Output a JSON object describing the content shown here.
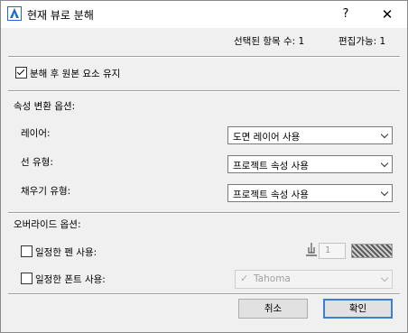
{
  "window": {
    "title": "현재 뷰로 분해",
    "help": "?",
    "close": "✕"
  },
  "info": {
    "selected": "선택된 항목 수: 1",
    "editable": "편집가능: 1"
  },
  "keep_original": {
    "label": "분해 후 원본 요소 유지",
    "checked": true
  },
  "attr_section": {
    "title": "속성 변환 옵션:",
    "layer": {
      "label": "레이어:",
      "value": "도면 레이어 사용"
    },
    "line_type": {
      "label": "선 유형:",
      "value": "프로젝트 속성 사용"
    },
    "fill_type": {
      "label": "채우기 유형:",
      "value": "프로젝트 속성 사용"
    }
  },
  "override_section": {
    "title": "오버라이드 옵션:",
    "uniform_pen": {
      "label": "일정한 펜 사용:",
      "checked": false,
      "pen_number": "1"
    },
    "uniform_font": {
      "label": "일정한 폰트 사용:",
      "checked": false,
      "font": "Tahoma"
    }
  },
  "buttons": {
    "cancel": "취소",
    "ok": "확인"
  },
  "colors": {
    "accent": "#3c7fd4",
    "app_icon": "#2a63c9"
  }
}
